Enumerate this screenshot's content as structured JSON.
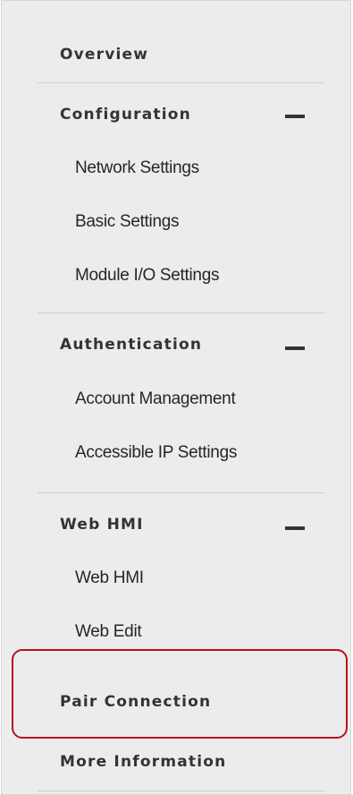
{
  "menu": {
    "overview": "Overview",
    "configuration": {
      "label": "Configuration",
      "items": [
        "Network Settings",
        "Basic Settings",
        "Module I/O Settings"
      ]
    },
    "authentication": {
      "label": "Authentication",
      "items": [
        "Account Management",
        "Accessible IP Settings"
      ]
    },
    "web_hmi": {
      "label": "Web HMI",
      "items": [
        "Web HMI",
        "Web Edit"
      ]
    },
    "pair_connection": "Pair Connection",
    "more_information": "More Information"
  },
  "icons": {
    "collapse": "minus-icon"
  },
  "colors": {
    "sidebar_bg": "#ececec",
    "highlight": "#b5121b",
    "text": "#333333"
  }
}
